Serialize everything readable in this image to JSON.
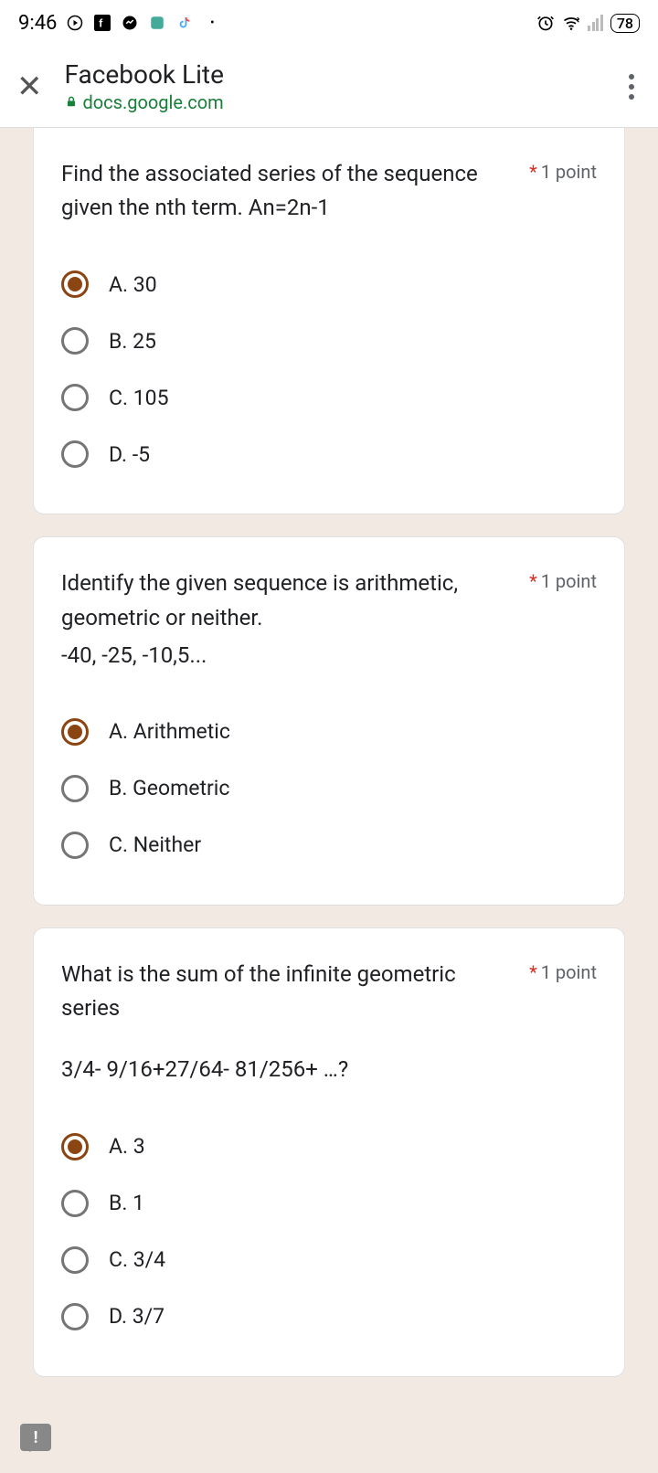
{
  "status": {
    "time": "9:46",
    "battery": "78"
  },
  "header": {
    "title": "Facebook Lite",
    "url": "docs.google.com"
  },
  "points_label": "1 point",
  "questions": [
    {
      "text": "Find the associated series of the sequence given the nth term. An=2n-1",
      "subtext": "",
      "selected": 0,
      "options": [
        "A.  30",
        "B. 25",
        "C. 105",
        "D. -5"
      ]
    },
    {
      "text": "Identify the given sequence is arithmetic, geometric or neither.",
      "subtext": "-40, -25, -10,5...",
      "selected": 0,
      "options": [
        "A. Arithmetic",
        "B. Geometric",
        "C. Neither"
      ]
    },
    {
      "text": "What is the sum of the infinite geometric series",
      "subtext": "3/4-  9/16+27/64- 81/256+ …?",
      "selected": 0,
      "options": [
        "A. 3",
        "B. 1",
        "C. 3/4",
        "D. 3/7"
      ]
    }
  ]
}
